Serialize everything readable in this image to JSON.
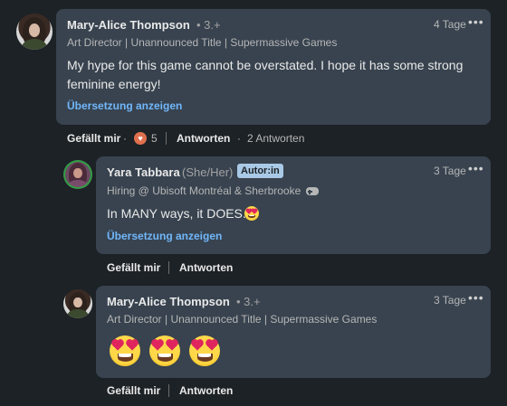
{
  "comment": {
    "author": "Mary-Alice Thompson",
    "degree": "• 3.+",
    "headline": "Art Director | Unannounced Title | Supermassive Games",
    "time": "4 Tage",
    "text": "My hype for this game cannot be overstated. I hope it has some strong feminine energy!",
    "translate": "Übersetzung anzeigen",
    "like": "Gefällt mir",
    "reaction_count": "5",
    "reply": "Antworten",
    "reply_count": "2 Antworten",
    "reaction_icon": "heart-reaction-icon"
  },
  "replies": [
    {
      "author": "Yara Tabbara",
      "pronouns": "(She/Her)",
      "badge": "Autor:in",
      "headline": "Hiring @ Ubisoft Montréal & Sherbrooke",
      "headline_icon": "gamepad-icon",
      "time": "3 Tage",
      "text": "In MANY ways, it DOES.",
      "text_emoji": "heart-eyes-emoji",
      "translate": "Übersetzung anzeigen",
      "like": "Gefällt mir",
      "reply": "Antworten"
    },
    {
      "author": "Mary-Alice Thompson",
      "degree": "• 3.+",
      "headline": "Art Director | Unannounced Title | Supermassive Games",
      "time": "3 Tage",
      "emojis": [
        "heart-eyes-emoji",
        "heart-eyes-emoji",
        "heart-eyes-emoji"
      ],
      "like": "Gefällt mir",
      "reply": "Antworten"
    }
  ],
  "colors": {
    "background": "#1d2226",
    "card": "#38434f",
    "link": "#71b7fb",
    "badge": "#a9c9e6",
    "reaction": "#df704d"
  }
}
